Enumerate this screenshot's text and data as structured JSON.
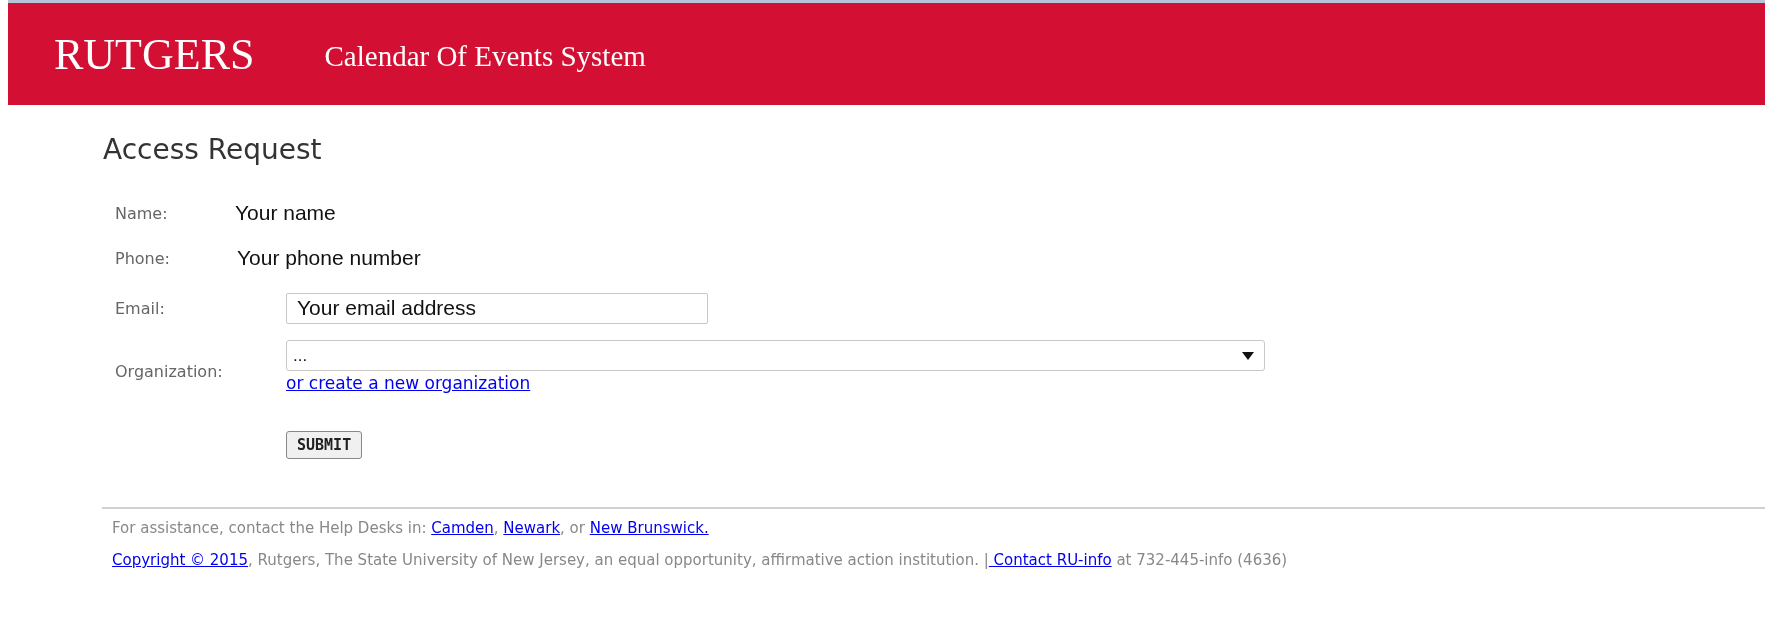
{
  "header": {
    "logo": "RUTGERS",
    "title": "Calendar Of Events System"
  },
  "page_title": "Access Request",
  "form": {
    "rows": [
      {
        "kind": "text",
        "label": "Name:",
        "value": "Your name"
      },
      {
        "kind": "text",
        "label": "Phone:",
        "value": "Your phone number"
      },
      {
        "kind": "input",
        "label": "Email:",
        "value": "Your email address"
      },
      {
        "kind": "select",
        "label": "Organization:",
        "value": "...",
        "link": "or create a new organization"
      }
    ],
    "submit": "SUBMIT"
  },
  "footer": {
    "lines": [
      [
        {
          "kind": "text",
          "text": "For assistance, contact the Help Desks in: "
        },
        {
          "kind": "link",
          "text": "Camden"
        },
        {
          "kind": "text",
          "text": ", "
        },
        {
          "kind": "link",
          "text": "Newark"
        },
        {
          "kind": "text",
          "text": ", or "
        },
        {
          "kind": "link",
          "text": "New Brunswick."
        }
      ],
      [
        {
          "kind": "link",
          "text": "Copyright © 2015"
        },
        {
          "kind": "text",
          "text": ", Rutgers, The State University of New Jersey, an equal opportunity, affirmative action institution. |"
        },
        {
          "kind": "link",
          "text": " Contact RU-info"
        },
        {
          "kind": "text",
          "text": " at 732-445-info (4636)"
        }
      ]
    ]
  }
}
